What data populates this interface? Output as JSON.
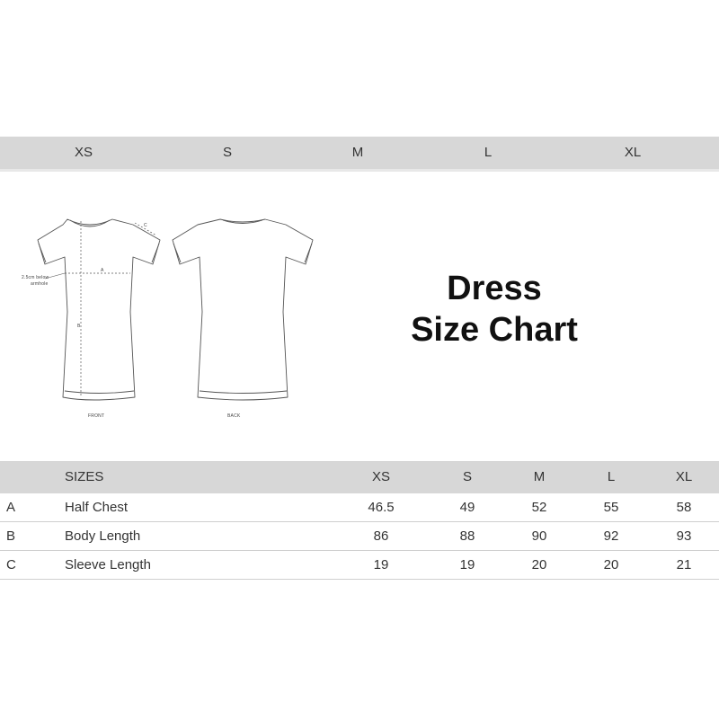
{
  "size_bar": {
    "labels": [
      "XS",
      "S",
      "M",
      "L",
      "XL"
    ]
  },
  "figure": {
    "front_label": "FRONT",
    "back_label": "BACK",
    "marker_a": "A",
    "marker_b": "B",
    "marker_c": "C",
    "note_line1": "2.5cm below",
    "note_line2": "armhole"
  },
  "title": {
    "line1": "Dress",
    "line2": "Size Chart"
  },
  "table": {
    "header": {
      "sizes_label": "SIZES",
      "columns": [
        "XS",
        "S",
        "M",
        "L",
        "XL"
      ]
    },
    "rows": [
      {
        "letter": "A",
        "name": "Half Chest",
        "values": [
          "46.5",
          "49",
          "52",
          "55",
          "58"
        ]
      },
      {
        "letter": "B",
        "name": "Body Length",
        "values": [
          "86",
          "88",
          "90",
          "92",
          "93"
        ]
      },
      {
        "letter": "C",
        "name": "Sleeve Length",
        "values": [
          "19",
          "19",
          "20",
          "20",
          "21"
        ]
      }
    ]
  }
}
